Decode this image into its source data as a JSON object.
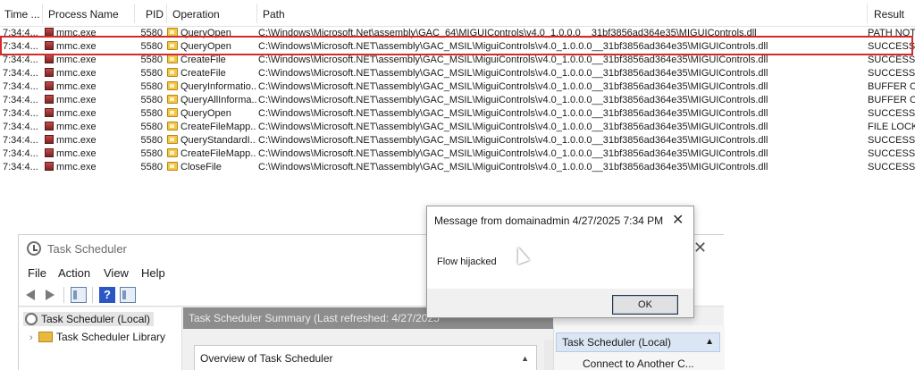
{
  "procmon": {
    "columns": [
      "Time ...",
      "Process Name",
      "PID",
      "Operation",
      "Path",
      "Result"
    ],
    "rows": [
      {
        "time": "7:34:4...",
        "process": "mmc.exe",
        "pid": "5580",
        "operation": "QueryOpen",
        "path": "C:\\Windows\\Microsoft.Net\\assembly\\GAC_64\\MIGUIControls\\v4.0_1.0.0.0__31bf3856ad364e35\\MIGUIControls.dll",
        "result": "PATH NOT..."
      },
      {
        "time": "7:34:4...",
        "process": "mmc.exe",
        "pid": "5580",
        "operation": "QueryOpen",
        "path": "C:\\Windows\\Microsoft.NET\\assembly\\GAC_MSIL\\MiguiControls\\v4.0_1.0.0.0__31bf3856ad364e35\\MIGUIControls.dll",
        "result": "SUCCESS"
      },
      {
        "time": "7:34:4...",
        "process": "mmc.exe",
        "pid": "5580",
        "operation": "CreateFile",
        "path": "C:\\Windows\\Microsoft.NET\\assembly\\GAC_MSIL\\MiguiControls\\v4.0_1.0.0.0__31bf3856ad364e35\\MIGUIControls.dll",
        "result": "SUCCESS"
      },
      {
        "time": "7:34:4...",
        "process": "mmc.exe",
        "pid": "5580",
        "operation": "CreateFile",
        "path": "C:\\Windows\\Microsoft.NET\\assembly\\GAC_MSIL\\MiguiControls\\v4.0_1.0.0.0__31bf3856ad364e35\\MIGUIControls.dll",
        "result": "SUCCESS"
      },
      {
        "time": "7:34:4...",
        "process": "mmc.exe",
        "pid": "5580",
        "operation": "QueryInformatio...",
        "path": "C:\\Windows\\Microsoft.NET\\assembly\\GAC_MSIL\\MiguiControls\\v4.0_1.0.0.0__31bf3856ad364e35\\MIGUIControls.dll",
        "result": "BUFFER O..."
      },
      {
        "time": "7:34:4...",
        "process": "mmc.exe",
        "pid": "5580",
        "operation": "QueryAllInforma...",
        "path": "C:\\Windows\\Microsoft.NET\\assembly\\GAC_MSIL\\MiguiControls\\v4.0_1.0.0.0__31bf3856ad364e35\\MIGUIControls.dll",
        "result": "BUFFER O..."
      },
      {
        "time": "7:34:4...",
        "process": "mmc.exe",
        "pid": "5580",
        "operation": "QueryOpen",
        "path": "C:\\Windows\\Microsoft.NET\\assembly\\GAC_MSIL\\MiguiControls\\v4.0_1.0.0.0__31bf3856ad364e35\\MIGUIControls.dll",
        "result": "SUCCESS"
      },
      {
        "time": "7:34:4...",
        "process": "mmc.exe",
        "pid": "5580",
        "operation": "CreateFileMapp...",
        "path": "C:\\Windows\\Microsoft.NET\\assembly\\GAC_MSIL\\MiguiControls\\v4.0_1.0.0.0__31bf3856ad364e35\\MIGUIControls.dll",
        "result": "FILE LOCK..."
      },
      {
        "time": "7:34:4...",
        "process": "mmc.exe",
        "pid": "5580",
        "operation": "QueryStandardI...",
        "path": "C:\\Windows\\Microsoft.NET\\assembly\\GAC_MSIL\\MiguiControls\\v4.0_1.0.0.0__31bf3856ad364e35\\MIGUIControls.dll",
        "result": "SUCCESS"
      },
      {
        "time": "7:34:4...",
        "process": "mmc.exe",
        "pid": "5580",
        "operation": "CreateFileMapp...",
        "path": "C:\\Windows\\Microsoft.NET\\assembly\\GAC_MSIL\\MiguiControls\\v4.0_1.0.0.0__31bf3856ad364e35\\MIGUIControls.dll",
        "result": "SUCCESS"
      },
      {
        "time": "7:34:4...",
        "process": "mmc.exe",
        "pid": "5580",
        "operation": "CloseFile",
        "path": "C:\\Windows\\Microsoft.NET\\assembly\\GAC_MSIL\\MiguiControls\\v4.0_1.0.0.0__31bf3856ad364e35\\MIGUIControls.dll",
        "result": "SUCCESS"
      }
    ],
    "highlight_color": "#d32b2b"
  },
  "task_scheduler": {
    "title": "Task Scheduler",
    "menu": [
      "File",
      "Action",
      "View",
      "Help"
    ],
    "toolbar_icons": [
      "back-arrow-icon",
      "forward-arrow-icon",
      "show-hide-console-tree-icon",
      "help-icon",
      "show-hide-action-pane-icon"
    ],
    "tree": [
      "Task Scheduler (Local)",
      "Task Scheduler Library"
    ],
    "summary_title": "Task Scheduler Summary (Last refreshed: 4/27/2025",
    "overview_label": "Overview of Task Scheduler",
    "actions_header": "Task Scheduler (Local)",
    "action_item": "Connect to Another C..."
  },
  "dialog": {
    "title": "Message from domainadmin 4/27/2025 7:34 PM",
    "message": "Flow hijacked",
    "ok_label": "OK",
    "close_glyph": "✕"
  }
}
